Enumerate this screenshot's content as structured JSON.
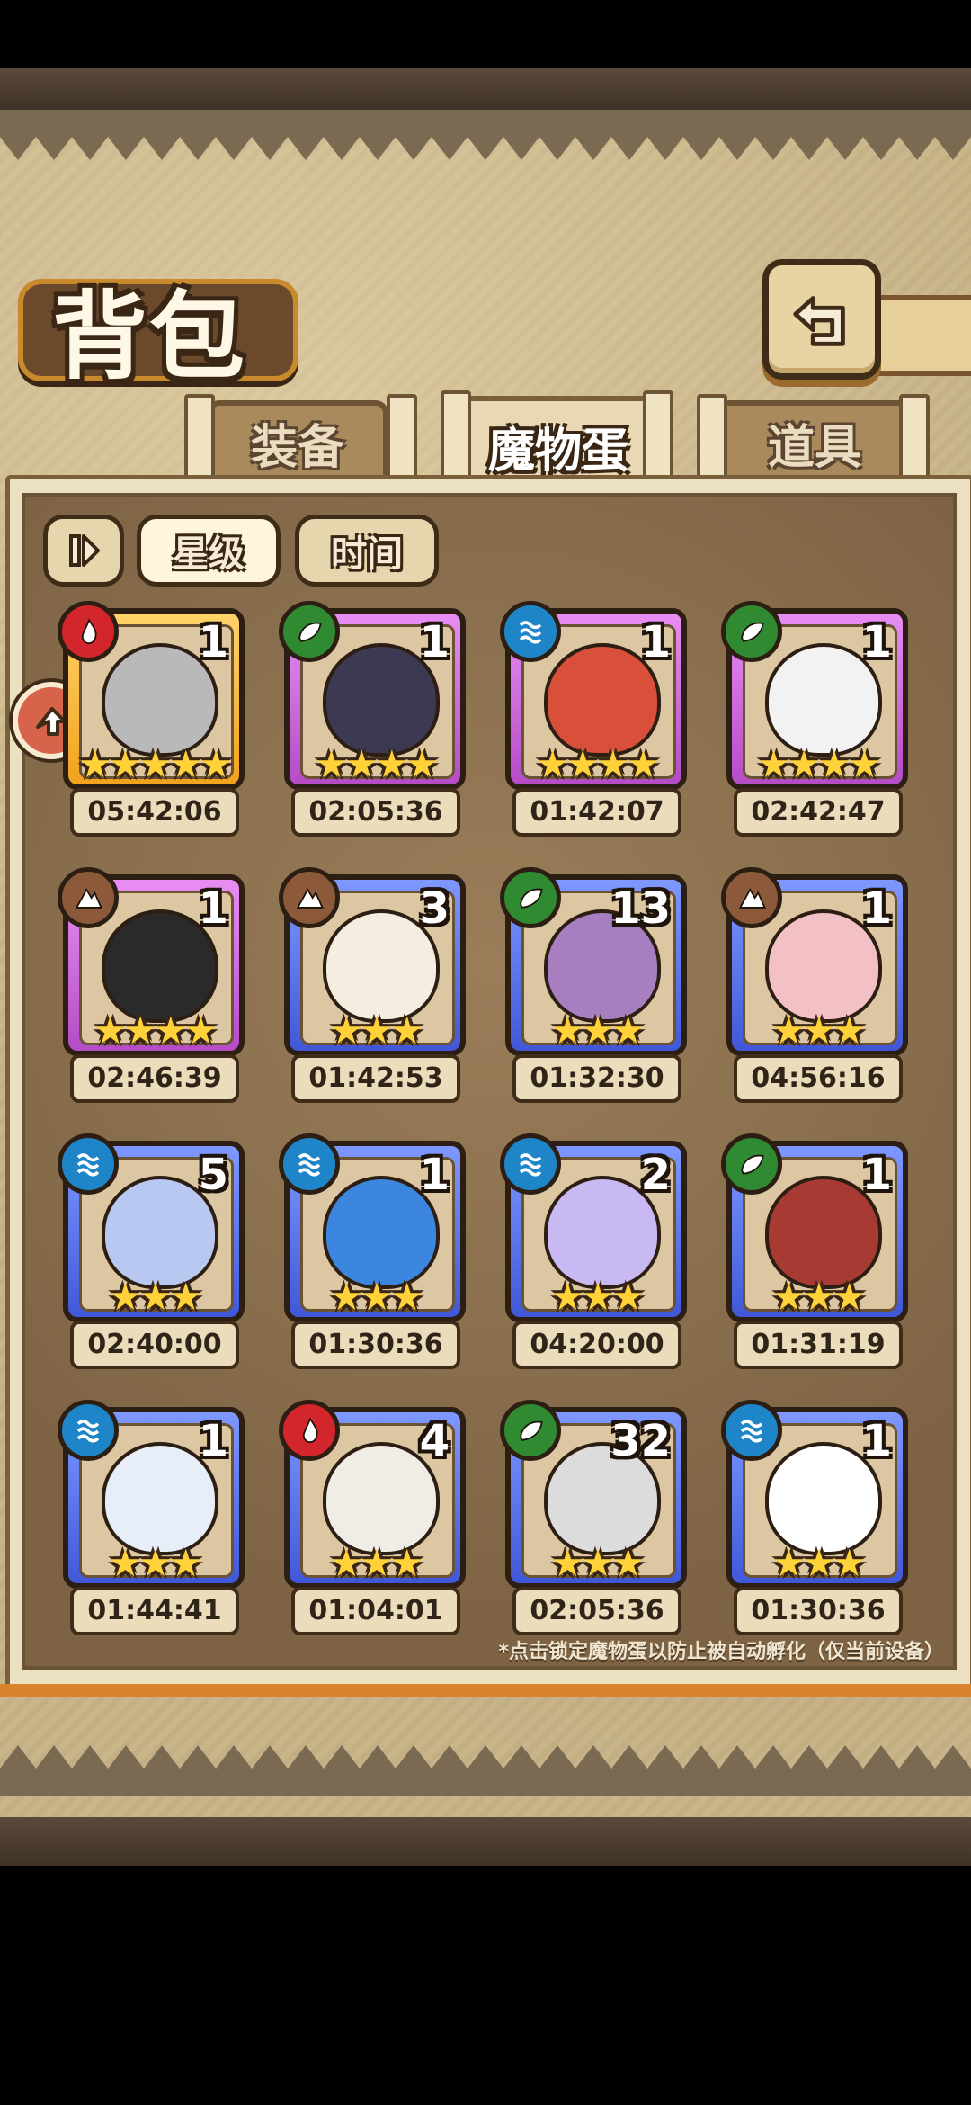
{
  "screen": {
    "title": "背包",
    "tabs": [
      {
        "label": "装备",
        "active": false
      },
      {
        "label": "魔物蛋",
        "active": true
      },
      {
        "label": "道具",
        "active": false
      }
    ],
    "filters": [
      {
        "label": "星级",
        "active": true
      },
      {
        "label": "时间",
        "active": false
      }
    ],
    "hint": "*点击锁定魔物蛋以防止被自动孵化（仅当前设备）"
  },
  "eggs": [
    {
      "element": "fire",
      "frame": "orange",
      "count": "1",
      "stars": 5,
      "timer": "05:42:06",
      "icon": "battleship-egg-icon"
    },
    {
      "element": "leaf",
      "frame": "purple",
      "count": "1",
      "stars": 4,
      "timer": "02:05:36",
      "icon": "spiked-collar-egg-icon"
    },
    {
      "element": "water",
      "frame": "purple",
      "count": "1",
      "stars": 4,
      "timer": "01:42:07",
      "icon": "feathered-egg-icon"
    },
    {
      "element": "leaf",
      "frame": "purple",
      "count": "1",
      "stars": 4,
      "timer": "02:42:47",
      "icon": "winged-rock-egg-icon"
    },
    {
      "element": "earth",
      "frame": "purple",
      "count": "1",
      "stars": 4,
      "timer": "02:46:39",
      "icon": "spider-egg-icon"
    },
    {
      "element": "earth",
      "frame": "blue",
      "count": "3",
      "stars": 3,
      "timer": "01:42:53",
      "icon": "fluffy-egg-icon"
    },
    {
      "element": "leaf",
      "frame": "blue",
      "count": "13",
      "stars": 3,
      "timer": "01:32:30",
      "icon": "iridescent-egg-icon"
    },
    {
      "element": "earth",
      "frame": "blue",
      "count": "1",
      "stars": 3,
      "timer": "04:56:16",
      "icon": "ribbon-egg-icon"
    },
    {
      "element": "water",
      "frame": "blue",
      "count": "5",
      "stars": 3,
      "timer": "02:40:00",
      "icon": "crystal-egg-icon"
    },
    {
      "element": "water",
      "frame": "blue",
      "count": "1",
      "stars": 3,
      "timer": "01:30:36",
      "icon": "cyclops-egg-icon"
    },
    {
      "element": "water",
      "frame": "blue",
      "count": "2",
      "stars": 3,
      "timer": "04:20:00",
      "icon": "jellyfish-egg-icon"
    },
    {
      "element": "leaf",
      "frame": "blue",
      "count": "1",
      "stars": 3,
      "timer": "01:31:19",
      "icon": "mushroom-egg-icon"
    },
    {
      "element": "water",
      "frame": "blue",
      "count": "1",
      "stars": 3,
      "timer": "01:44:41",
      "icon": "cloud-egg-icon"
    },
    {
      "element": "fire",
      "frame": "blue",
      "count": "4",
      "stars": 3,
      "timer": "01:04:01",
      "icon": "flame-egg-icon"
    },
    {
      "element": "leaf",
      "frame": "blue",
      "count": "32",
      "stars": 3,
      "timer": "02:05:36",
      "icon": "spiked-collar-egg-icon"
    },
    {
      "element": "water",
      "frame": "blue",
      "count": "1",
      "stars": 3,
      "timer": "01:30:36",
      "icon": "bow-egg-icon"
    }
  ]
}
